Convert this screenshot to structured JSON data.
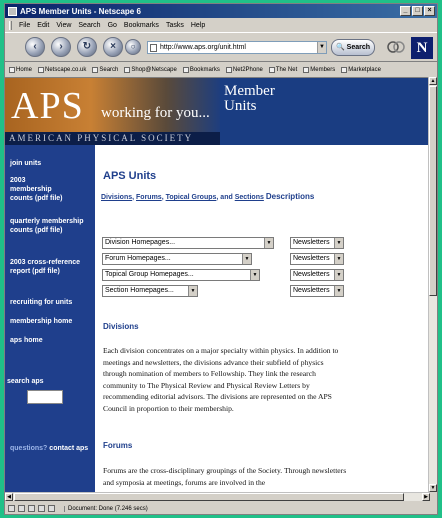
{
  "window": {
    "title": "APS Member Units - Netscape 6"
  },
  "menu": [
    "File",
    "Edit",
    "View",
    "Search",
    "Go",
    "Bookmarks",
    "Tasks",
    "Help"
  ],
  "nav": {
    "url": "http://www.aps.org/unit.html",
    "search_label": "Search"
  },
  "bookmarks": [
    "Home",
    "Netscape.co.uk",
    "Search",
    "Shop@Netscape",
    "Bookmarks",
    "Net2Phone",
    "The Net",
    "Members",
    "Marketplace"
  ],
  "banner": {
    "big": "APS",
    "tagline": "working for you...",
    "title_line1": "Member",
    "title_line2": "Units",
    "strip": "AMERICAN PHYSICAL SOCIETY"
  },
  "sidebar": {
    "join": "join units",
    "counts_2003": "2003 membership counts (pdf file)",
    "quarterly": "quarterly membership counts (pdf file)",
    "crossref": "2003 cross-reference report (pdf file)",
    "recruiting": "recruiting for units",
    "home": "membership home",
    "aps_home": "aps home",
    "search_label": "search aps",
    "questions": "questions?",
    "contact": "contact aps"
  },
  "main": {
    "heading": "APS Units",
    "links": {
      "divisions": "Divisions",
      "forums": "Forums",
      "groups": "Topical Groups",
      "and": "and",
      "sections": "Sections",
      "descriptions": "Descriptions"
    },
    "selects": [
      {
        "label": "Division Homepages...",
        "news": "Newsletters"
      },
      {
        "label": "Forum Homepages...",
        "news": "Newsletters"
      },
      {
        "label": "Topical Group Homepages...",
        "news": "Newsletters"
      },
      {
        "label": "Section Homepages...",
        "news": "Newsletters"
      }
    ],
    "divisions_heading": "Divisions",
    "divisions_text": "Each division concentrates on a major specialty within physics. In addition to meetings and newsletters, the divisions advance their subfield of physics through nomination of members to Fellowship. They link the research community to The Physical Review and Physical Review Letters by recommending editorial advisors. The divisions are represented on the APS Council in proportion to their membership.",
    "forums_heading": "Forums",
    "forums_text": "Forums are the cross-disciplinary groupings of the Society. Through newsletters and symposia at meetings, forums are involved in the"
  },
  "status": {
    "text": "Document: Done (7.246 secs)"
  }
}
